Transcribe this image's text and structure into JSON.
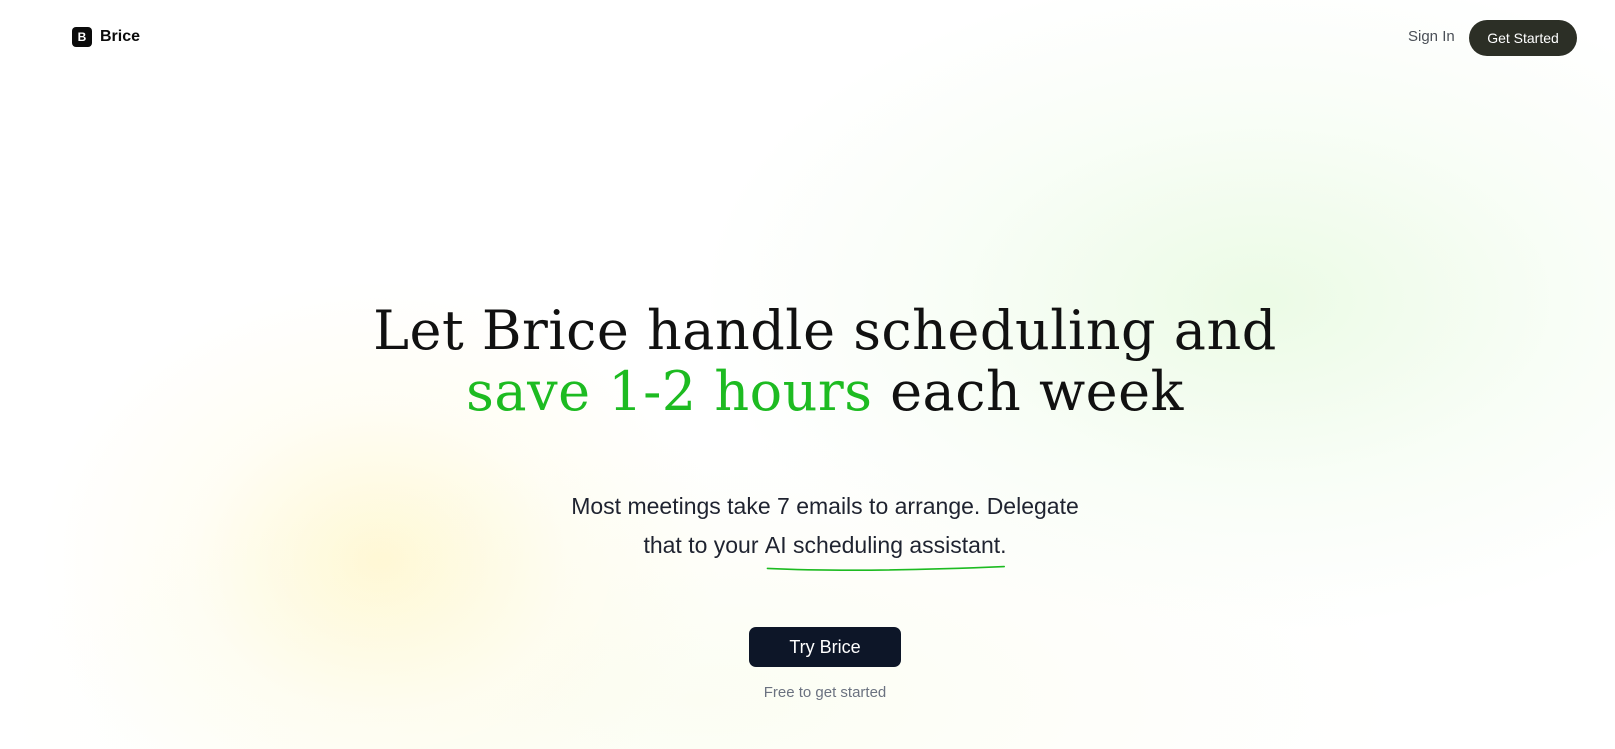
{
  "header": {
    "logo_letter": "B",
    "brand_name": "Brice",
    "sign_in_label": "Sign In",
    "get_started_label": "Get Started"
  },
  "hero": {
    "headline_line1": "Let Brice handle scheduling and",
    "headline_accent": "save 1-2 hours",
    "headline_rest": " each week",
    "subhead_line1": "Most meetings take 7 emails to arrange. Delegate",
    "subhead_line2_prefix": "that to your ",
    "subhead_highlight": "AI scheduling assistant.",
    "cta_label": "Try Brice",
    "cta_note": "Free to get started"
  },
  "colors": {
    "accent_green": "#1dbb21",
    "cta_background": "#0d1628",
    "header_button_background": "#2c2f26"
  }
}
